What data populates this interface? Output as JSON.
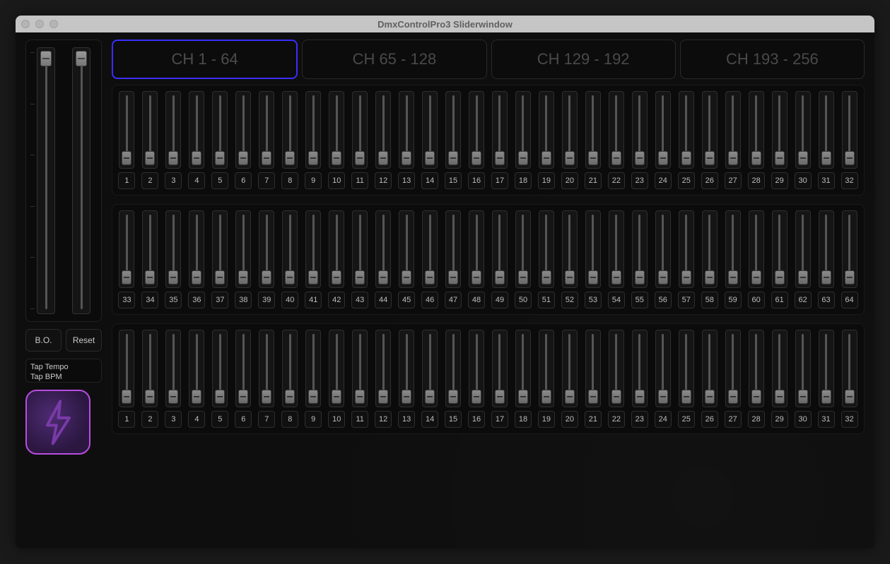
{
  "window": {
    "title": "DmxControlPro3 Sliderwindow"
  },
  "tabs": [
    {
      "label": "CH 1 - 64",
      "active": true
    },
    {
      "label": "CH 65 - 128",
      "active": false
    },
    {
      "label": "CH 129 - 192",
      "active": false
    },
    {
      "label": "CH 193 - 256",
      "active": false
    }
  ],
  "masters": [
    {
      "name": "master-a",
      "value": 100
    },
    {
      "name": "master-b",
      "value": 100
    }
  ],
  "buttons": {
    "blackout": "B.O.",
    "reset": "Reset"
  },
  "tap": {
    "line1": "Tap Tempo",
    "line2": "Tap BPM"
  },
  "icon": {
    "name": "lightning-icon"
  },
  "rows": [
    {
      "labels": [
        "1",
        "2",
        "3",
        "4",
        "5",
        "6",
        "7",
        "8",
        "9",
        "10",
        "11",
        "12",
        "13",
        "14",
        "15",
        "16",
        "17",
        "18",
        "19",
        "20",
        "21",
        "22",
        "23",
        "24",
        "25",
        "26",
        "27",
        "28",
        "29",
        "30",
        "31",
        "32"
      ]
    },
    {
      "labels": [
        "33",
        "34",
        "35",
        "36",
        "37",
        "38",
        "39",
        "40",
        "41",
        "42",
        "43",
        "44",
        "45",
        "46",
        "47",
        "48",
        "49",
        "50",
        "51",
        "52",
        "53",
        "54",
        "55",
        "56",
        "57",
        "58",
        "59",
        "60",
        "61",
        "62",
        "63",
        "64"
      ]
    },
    {
      "labels": [
        "1",
        "2",
        "3",
        "4",
        "5",
        "6",
        "7",
        "8",
        "9",
        "10",
        "11",
        "12",
        "13",
        "14",
        "15",
        "16",
        "17",
        "18",
        "19",
        "20",
        "21",
        "22",
        "23",
        "24",
        "25",
        "26",
        "27",
        "28",
        "29",
        "30",
        "31",
        "32"
      ]
    }
  ],
  "slider_value_default": 0
}
